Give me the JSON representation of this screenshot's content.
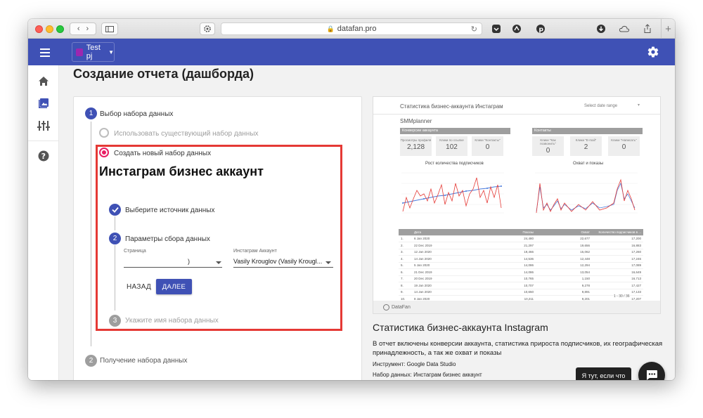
{
  "browser": {
    "url": "datafan.pro"
  },
  "header": {
    "project_label": "Test pj"
  },
  "page": {
    "title": "Создание отчета (дашборда)"
  },
  "stepper": {
    "step1_num": "1",
    "step1_label": "Выбор набора данных",
    "option_existing": "Использовать существующий набор данных",
    "option_new": "Создать новый набор данных",
    "dataset_title": "Инстаграм бизнес аккаунт",
    "sub1_label": "Выберите источник данных",
    "sub2_num": "2",
    "sub2_label": "Параметры сбора данных",
    "field_page_label": "Страница",
    "field_page_value": ")",
    "field_account_label": "Инстаграм Аккаунт",
    "field_account_value": "Vasily Krouglov (Vasily Krougl...",
    "back_button": "НАЗАД",
    "next_button": "ДАЛЕЕ",
    "sub3_num": "3",
    "sub3_label": "Укажите имя набора данных",
    "step2_num": "2",
    "step2_label": "Получение набора данных"
  },
  "preview": {
    "report_title": "Статистика бизнес-аккаунта Инстаграм",
    "date_range": "Select date range",
    "brand": "SMMplanner",
    "section_conversions": "Конверсии аккаунта",
    "section_contacts": "Контакты",
    "kpis_left": [
      {
        "label": "Просмотры профиля",
        "value": "2,128"
      },
      {
        "label": "Клики по ссылке",
        "value": "102"
      },
      {
        "label": "Клики \"Контакты\"",
        "value": "0"
      }
    ],
    "kpis_right": [
      {
        "label": "Клики \"Как позвонить\"",
        "value": "0"
      },
      {
        "label": "Клики \"E-mail\"",
        "value": "2"
      },
      {
        "label": "Клики \"Написать\"",
        "value": "0"
      }
    ],
    "chart1_title": "Рост количества подписчиков",
    "chart2_title": "Охват и показы",
    "table_headers": [
      "",
      "Дата",
      "Показы",
      "Охват",
      "Количество подписчиков в ..."
    ],
    "table_rows": [
      [
        "1.",
        "6 Jan 2020",
        "24,480",
        "22,677",
        "17,200"
      ],
      [
        "2.",
        "22 Dec 2019",
        "21,297",
        "19,656",
        "16,883"
      ],
      [
        "3.",
        "12 Jan 2020",
        "19,466",
        "15,062",
        "17,260"
      ],
      [
        "4.",
        "14 Jan 2020",
        "14,536",
        "12,448",
        "17,246"
      ],
      [
        "5.",
        "5 Jan 2020",
        "14,086",
        "12,294",
        "17,089"
      ],
      [
        "6.",
        "21 Dec 2019",
        "14,086",
        "13,054",
        "16,649"
      ],
      [
        "7.",
        "20 Dec 2019",
        "10,765",
        "1,150",
        "16,713"
      ],
      [
        "8.",
        "19 Jan 2020",
        "10,707",
        "9,278",
        "17,427"
      ],
      [
        "9.",
        "14 Jan 2020",
        "10,650",
        "9,891",
        "17,133"
      ],
      [
        "10.",
        "8 Jan 2020",
        "10,211",
        "9,201",
        "17,207"
      ]
    ],
    "pagination": "1 - 30 / 36",
    "footer_brand": "DataFan"
  },
  "description": {
    "title": "Статистика бизнес-аккаунта Instagram",
    "text": "В отчет включены конверсии аккаунта, статистика прироста подписчиков, их географическая принадлежность, а так же охват и показы",
    "tool": "Инструмент: Google Data Studio",
    "dataset": "Набор данных: Инстаграм бизнес аккаунт"
  },
  "chat": {
    "tooltip": "Я тут, если что"
  },
  "colors": {
    "primary": "#3f51b5",
    "accent_pink": "#e91e63",
    "highlight_red": "#e53935"
  }
}
